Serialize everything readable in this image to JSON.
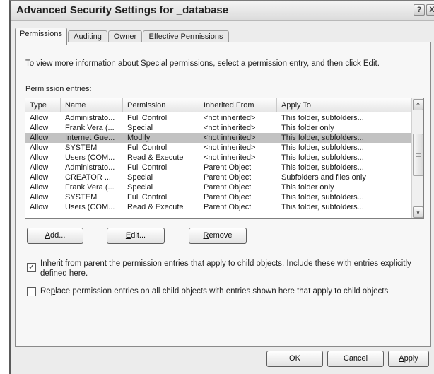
{
  "window": {
    "title": "Advanced Security Settings for _database",
    "help_glyph": "?",
    "close_glyph": "X"
  },
  "tabs": [
    {
      "label": "Permissions",
      "active": true
    },
    {
      "label": "Auditing",
      "active": false
    },
    {
      "label": "Owner",
      "active": false
    },
    {
      "label": "Effective Permissions",
      "active": false
    }
  ],
  "intro_text": "To view more information about Special permissions, select a permission entry, and then click Edit.",
  "entries_label": "Permission entries:",
  "columns": [
    "Type",
    "Name",
    "Permission",
    "Inherited From",
    "Apply To"
  ],
  "rows": [
    {
      "type": "Allow",
      "name": "Administrato...",
      "permission": "Full Control",
      "inherited": "<not inherited>",
      "apply": "This folder, subfolders...",
      "selected": false
    },
    {
      "type": "Allow",
      "name": "Frank Vera (...",
      "permission": "Special",
      "inherited": "<not inherited>",
      "apply": "This folder only",
      "selected": false
    },
    {
      "type": "Allow",
      "name": "Internet Gue...",
      "permission": "Modify",
      "inherited": "<not inherited>",
      "apply": "This folder, subfolders...",
      "selected": true
    },
    {
      "type": "Allow",
      "name": "SYSTEM",
      "permission": "Full Control",
      "inherited": "<not inherited>",
      "apply": "This folder, subfolders...",
      "selected": false
    },
    {
      "type": "Allow",
      "name": "Users (COM...",
      "permission": "Read & Execute",
      "inherited": "<not inherited>",
      "apply": "This folder, subfolders...",
      "selected": false
    },
    {
      "type": "Allow",
      "name": "Administrato...",
      "permission": "Full Control",
      "inherited": "Parent Object",
      "apply": "This folder, subfolders...",
      "selected": false
    },
    {
      "type": "Allow",
      "name": "CREATOR ...",
      "permission": "Special",
      "inherited": "Parent Object",
      "apply": "Subfolders and files only",
      "selected": false
    },
    {
      "type": "Allow",
      "name": "Frank Vera (...",
      "permission": "Special",
      "inherited": "Parent Object",
      "apply": "This folder only",
      "selected": false
    },
    {
      "type": "Allow",
      "name": "SYSTEM",
      "permission": "Full Control",
      "inherited": "Parent Object",
      "apply": "This folder, subfolders...",
      "selected": false
    },
    {
      "type": "Allow",
      "name": "Users (COM...",
      "permission": "Read & Execute",
      "inherited": "Parent Object",
      "apply": "This folder, subfolders...",
      "selected": false
    }
  ],
  "list_buttons": {
    "add": {
      "mnemonic": "A",
      "rest": "dd..."
    },
    "edit": {
      "mnemonic": "E",
      "rest": "dit..."
    },
    "remove": {
      "mnemonic": "R",
      "rest": "emove"
    }
  },
  "inherit_checkbox": {
    "checked": true,
    "mnemonic": "I",
    "line1_rest": "nherit from parent the permission entries that apply to child objects. Include these with entries explicitly",
    "line2": "defined here."
  },
  "replace_checkbox": {
    "checked": false,
    "prefix": "Re",
    "mnemonic": "p",
    "rest": "lace permission entries on all child objects with entries shown here that apply to child objects"
  },
  "dialog_buttons": {
    "ok": "OK",
    "cancel": "Cancel",
    "apply": {
      "mnemonic": "A",
      "rest": "pply"
    }
  },
  "icons": {
    "scroll_up": "^",
    "scroll_down": "v",
    "check": "✓"
  }
}
